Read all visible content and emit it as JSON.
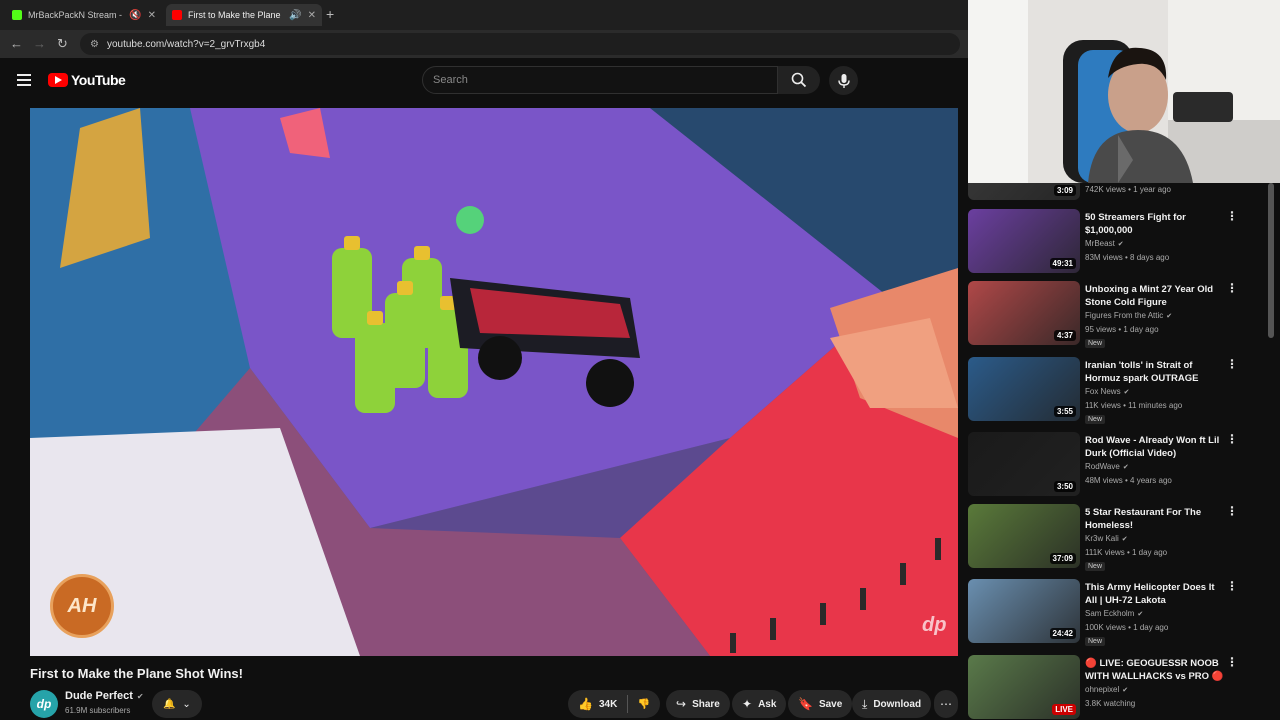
{
  "browser": {
    "tabs": [
      {
        "label": "MrBackPackN Stream - Wa",
        "favicon_color": "#53fc18"
      },
      {
        "label": "First to Make the Plane Sh",
        "favicon_color": "#ff0000"
      }
    ],
    "url": "youtube.com/watch?v=2_grvTrxgb4"
  },
  "youtube": {
    "logo_text": "YouTube",
    "search_placeholder": "Search"
  },
  "video": {
    "title": "First to Make the Plane Shot Wins!",
    "watermark_left": "AH",
    "watermark_right": "dp"
  },
  "channel": {
    "name": "Dude Perfect",
    "subscribers": "61.9M subscribers",
    "avatar_text": "dp"
  },
  "actions": {
    "likes": "34K",
    "share": "Share",
    "ask": "Ask",
    "save": "Save",
    "download": "Download"
  },
  "recommendations": [
    {
      "duration": "3:09",
      "title": "",
      "channel": "",
      "meta": "742K views • 1 year ago",
      "badge": "",
      "thumb_color": "#3b3b3b"
    },
    {
      "duration": "49:31",
      "title": "50 Streamers Fight for $1,000,000",
      "channel": "MrBeast",
      "meta": "83M views • 8 days ago",
      "badge": "",
      "thumb_color": "#6b3fa0"
    },
    {
      "duration": "4:37",
      "title": "Unboxing a Mint 27 Year Old Stone Cold Figure",
      "channel": "Figures From the Attic",
      "meta": "95 views • 1 day ago",
      "badge": "New",
      "thumb_color": "#b04848"
    },
    {
      "duration": "3:55",
      "title": "Iranian 'tolls' in Strait of Hormuz spark OUTRAGE",
      "channel": "Fox News",
      "meta": "11K views • 11 minutes ago",
      "badge": "New",
      "thumb_color": "#2b5b8a"
    },
    {
      "duration": "3:50",
      "title": "Rod Wave - Already Won ft Lil Durk (Official Video)",
      "channel": "RodWave",
      "meta": "48M views • 4 years ago",
      "badge": "",
      "thumb_color": "#1a1a1a"
    },
    {
      "duration": "37:09",
      "title": "5 Star Restaurant For The Homeless!",
      "channel": "Kr3w Kali",
      "meta": "111K views • 1 day ago",
      "badge": "New",
      "thumb_color": "#5a7a3a"
    },
    {
      "duration": "24:42",
      "title": "This Army Helicopter Does It All | UH-72 Lakota",
      "channel": "Sam Eckholm",
      "meta": "100K views • 1 day ago",
      "badge": "New",
      "thumb_color": "#6a8fb0"
    },
    {
      "duration": "LIVE",
      "title": "🔴 LIVE: GEOGUESSR NOOB WITH WALLHACKS vs PRO 🔴",
      "channel": "ohnepixel",
      "meta": "3.8K watching",
      "badge": "",
      "thumb_color": "#5a7a4a"
    }
  ]
}
